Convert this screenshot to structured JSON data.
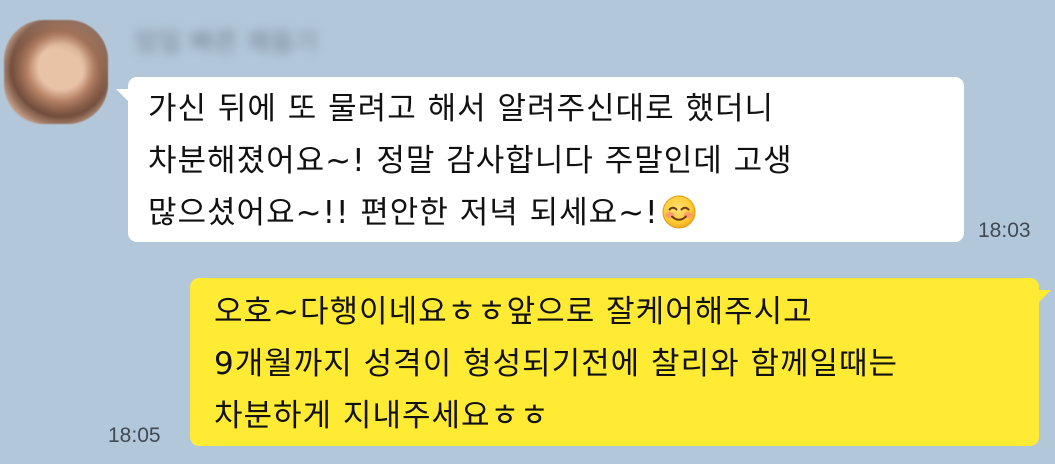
{
  "chat": {
    "received": {
      "sender_name": "띵일 빠른 꽤들기",
      "lines": [
        "가신 뒤에 또 물려고 해서 알려주신대로 했더니",
        "차분해졌어요~! 정말 감사합니다 주말인데 고생",
        "많으셨어요~!! 편안한 저녁 되세요~!"
      ],
      "emoji": "smiling-face-with-blush-icon",
      "time": "18:03"
    },
    "sent": {
      "lines": [
        "오호~다행이네요ㅎㅎ앞으로 잘케어해주시고",
        "9개월까지 성격이 형성되기전에 찰리와 함께일때는",
        "차분하게 지내주세요ㅎㅎ"
      ],
      "time": "18:05"
    }
  },
  "colors": {
    "background": "#b2c7d9",
    "received_bubble": "#ffffff",
    "sent_bubble": "#ffeb33",
    "text": "#111111",
    "timestamp": "#3f4a55"
  }
}
